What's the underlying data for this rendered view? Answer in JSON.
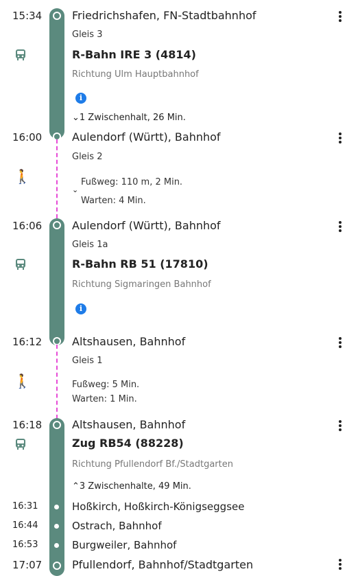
{
  "segments": {
    "s1": {
      "dep_time": "15:34",
      "dep_stop": "Friedrichshafen, FN-Stadtbahnhof",
      "platform": "Gleis 3",
      "line": "R-Bahn IRE 3 (4814)",
      "direction": "Richtung Ulm Hauptbahnhof",
      "intermediate_toggle": "⌄1 Zwischenhalt, 26 Min."
    },
    "s2": {
      "arr_time": "16:00",
      "arr_stop": "Aulendorf (Württ), Bahnhof",
      "platform": "Gleis 2",
      "walk": "Fußweg: 110 m, 2 Min.",
      "wait": "Warten: 4 Min."
    },
    "s3": {
      "dep_time": "16:06",
      "dep_stop": "Aulendorf (Württ), Bahnhof",
      "platform": "Gleis 1a",
      "line": "R-Bahn RB 51 (17810)",
      "direction": "Richtung Sigmaringen Bahnhof"
    },
    "s4": {
      "arr_time": "16:12",
      "arr_stop": "Altshausen, Bahnhof",
      "platform": "Gleis 1",
      "walk": "Fußweg: 5 Min.",
      "wait": "Warten: 1 Min."
    },
    "s5": {
      "dep_time": "16:18",
      "dep_stop": "Altshausen, Bahnhof",
      "line": "Zug RB54 (88228)",
      "direction": "Richtung Pfullendorf Bf./Stadtgarten",
      "intermediate_toggle": "⌃3 Zwischenhalte, 49 Min.",
      "stops": [
        {
          "time": "16:31",
          "name": "Hoßkirch, Hoßkirch-Königseggsee"
        },
        {
          "time": "16:44",
          "name": "Ostrach, Bahnhof"
        },
        {
          "time": "16:53",
          "name": "Burgweiler, Bahnhof"
        }
      ],
      "arr_time": "17:07",
      "arr_stop": "Pfullendorf, Bahnhof/Stadtgarten"
    }
  },
  "icons": {
    "info": "info-icon",
    "train": "train-icon",
    "walk": "walk-icon",
    "more": "more-vertical-icon"
  },
  "colors": {
    "rail": "#5b8a7e",
    "walk": "#e64bd6",
    "info": "#1e7ce8"
  }
}
